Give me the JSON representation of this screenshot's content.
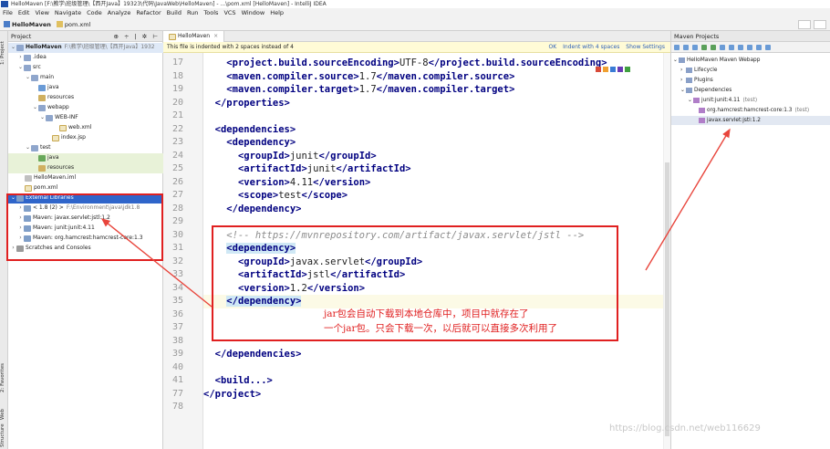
{
  "window": {
    "title": "HelloMaven [F:\\教学\\班级管理\\【西开Java】19323\\代码\\JavaWeb\\HelloMaven] - ...\\pom.xml [HelloMaven] - IntelliJ IDEA"
  },
  "menu": [
    "File",
    "Edit",
    "View",
    "Navigate",
    "Code",
    "Analyze",
    "Refactor",
    "Build",
    "Run",
    "Tools",
    "VCS",
    "Window",
    "Help"
  ],
  "breadcrumb": {
    "project": "HelloMaven",
    "file": "pom.xml"
  },
  "project_panel": {
    "title": "Project",
    "rows": [
      {
        "label": "HelloMaven",
        "extra": "F:\\教学\\班级管理\\【西开Java】1932"
      },
      {
        "label": ".idea"
      },
      {
        "label": "src"
      },
      {
        "label": "main"
      },
      {
        "label": "java"
      },
      {
        "label": "resources"
      },
      {
        "label": "webapp"
      },
      {
        "label": "WEB-INF"
      },
      {
        "label": "web.xml"
      },
      {
        "label": "index.jsp"
      },
      {
        "label": "test"
      },
      {
        "label": "java"
      },
      {
        "label": "resources"
      },
      {
        "label": "HelloMaven.iml"
      },
      {
        "label": "pom.xml"
      },
      {
        "label": "External Libraries"
      },
      {
        "label": "< 1.8 (2) >",
        "extra": "F:\\Environment\\java\\jdk1.8"
      },
      {
        "label": "Maven: javax.servlet:jstl:1.2"
      },
      {
        "label": "Maven: junit:junit:4.11"
      },
      {
        "label": "Maven: org.hamcrest:hamcrest-core:1.3"
      },
      {
        "label": "Scratches and Consoles"
      }
    ]
  },
  "left_stripe": {
    "project": "1: Project",
    "favorites": "2: Favorites",
    "web": "Web",
    "structure": "Structure"
  },
  "editor": {
    "tab": "HelloMaven",
    "banner": "This file is indented with 2 spaces instead of 4",
    "banner_actions": [
      "OK",
      "Indent with 4 spaces",
      "Show Settings"
    ],
    "lines": [
      {
        "n": "17",
        "code": "    <project.build.sourceEncoding>UTF-8</project.build.sourceEncoding>"
      },
      {
        "n": "18",
        "code": "    <maven.compiler.source>1.7</maven.compiler.source>"
      },
      {
        "n": "19",
        "code": "    <maven.compiler.target>1.7</maven.compiler.target>"
      },
      {
        "n": "20",
        "code": "  </properties>"
      },
      {
        "n": "21",
        "code": ""
      },
      {
        "n": "22",
        "code": "  <dependencies>"
      },
      {
        "n": "23",
        "code": "    <dependency>"
      },
      {
        "n": "24",
        "code": "      <groupId>junit</groupId>"
      },
      {
        "n": "25",
        "code": "      <artifactId>junit</artifactId>"
      },
      {
        "n": "26",
        "code": "      <version>4.11</version>"
      },
      {
        "n": "27",
        "code": "      <scope>test</scope>"
      },
      {
        "n": "28",
        "code": "    </dependency>"
      },
      {
        "n": "29",
        "code": ""
      },
      {
        "n": "30",
        "code": "    <!-- https://mvnrepository.com/artifact/javax.servlet/jstl -->"
      },
      {
        "n": "31",
        "code": "    <dependency>"
      },
      {
        "n": "32",
        "code": "      <groupId>javax.servlet</groupId>"
      },
      {
        "n": "33",
        "code": "      <artifactId>jstl</artifactId>"
      },
      {
        "n": "34",
        "code": "      <version>1.2</version>"
      },
      {
        "n": "35",
        "code": "    </dependency>"
      },
      {
        "n": "36",
        "code": ""
      },
      {
        "n": "37",
        "code": ""
      },
      {
        "n": "38",
        "code": ""
      },
      {
        "n": "39",
        "code": "  </dependencies>"
      },
      {
        "n": "40",
        "code": ""
      },
      {
        "n": "41",
        "code": "  <build...>"
      },
      {
        "n": "77",
        "code": "</project>"
      },
      {
        "n": "78",
        "code": ""
      }
    ]
  },
  "annotation": {
    "text": "jar包会自动下载到本地仓库中，项目中就存在了\n一个jar包。只会下载一次，以后就可以直接多次利用了"
  },
  "maven_panel": {
    "title": "Maven Projects",
    "rows": [
      {
        "label": "HelloMaven Maven Webapp"
      },
      {
        "label": "Lifecycle"
      },
      {
        "label": "Plugins"
      },
      {
        "label": "Dependencies"
      },
      {
        "label": "junit:junit:4.11",
        "extra": "(test)"
      },
      {
        "label": "org.hamcrest:hamcrest-core:1.3",
        "extra": "(test)"
      },
      {
        "label": "javax.servlet:jstl:1.2"
      }
    ]
  },
  "watermark": "https://blog.csdn.net/web116629"
}
